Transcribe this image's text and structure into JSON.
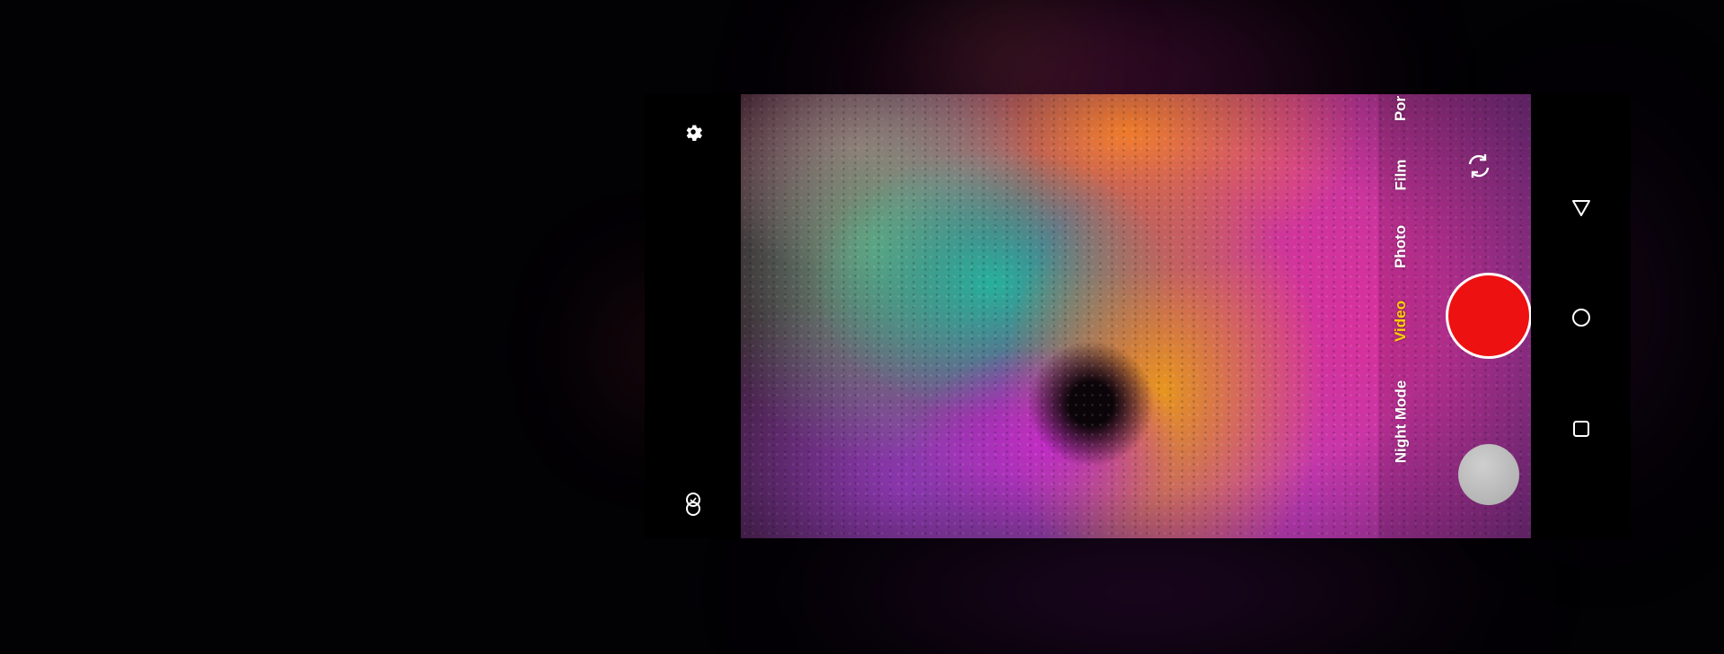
{
  "top_bar": {
    "settings_icon": "gear-icon",
    "lens_switch_icon": "lens-switch-icon"
  },
  "viewfinder": {
    "subject": "colorful-powder-explosion"
  },
  "modes": {
    "items": [
      {
        "label": "Por",
        "active": false
      },
      {
        "label": "Film",
        "active": false
      },
      {
        "label": "Photo",
        "active": false
      },
      {
        "label": "Video",
        "active": true
      },
      {
        "label": "Night Mode",
        "active": false
      }
    ],
    "active_color": "#ffd100"
  },
  "controls": {
    "flip_camera_icon": "flip-camera-icon",
    "shutter_color": "#ee1111",
    "gallery_icon": "gallery-thumbnail"
  },
  "nav_bar": {
    "back_icon": "back-triangle-icon",
    "home_icon": "home-circle-icon",
    "recents_icon": "recents-square-icon"
  }
}
